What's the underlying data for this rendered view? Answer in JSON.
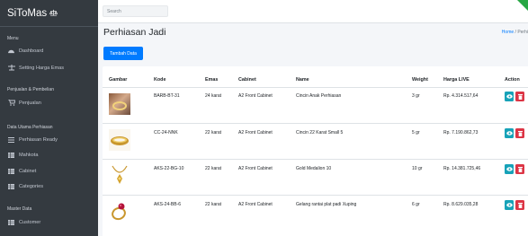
{
  "app": {
    "brand": "SiToMas"
  },
  "sidebar": {
    "sections": [
      "Menu",
      "Penjualan & Pembelian",
      "Data Utama Perhiasan",
      "Master Data"
    ],
    "items": [
      {
        "label": "Dashboard",
        "icon": "dashboard-icon"
      },
      {
        "label": "Setting Harga Emas",
        "icon": "scale-icon"
      },
      {
        "label": "Penjualan",
        "icon": "cart-icon"
      },
      {
        "label": "Perhiasan Ready",
        "icon": "list-icon"
      },
      {
        "label": "Mahkota",
        "icon": "table-icon"
      },
      {
        "label": "Cabinet",
        "icon": "table-icon"
      },
      {
        "label": "Categories",
        "icon": "table-icon"
      },
      {
        "label": "Customer",
        "icon": "table-icon"
      }
    ]
  },
  "topbar": {
    "search_placeholder": "Search"
  },
  "page": {
    "title": "Perhiasan Jadi",
    "breadcrumb_home": "Home",
    "breadcrumb_sep": "/",
    "breadcrumb_current": "Perhi",
    "add_button": "Tambah Data"
  },
  "table": {
    "headers": [
      "Gambar",
      "Kode",
      "Emas",
      "Cabinet",
      "Name",
      "Weight",
      "Harga LIVE",
      "Action"
    ],
    "rows": [
      {
        "kode": "BARB-BT-31",
        "emas": "24 karat",
        "cabinet": "A2 Front Cabinet",
        "name": "Cincin Anak Perhiasan",
        "weight": "3 gr",
        "harga": "Rp. 4.314.517,64",
        "image": "ring-photo"
      },
      {
        "kode": "CC-24-NNK",
        "emas": "22 karat",
        "cabinet": "A2 Front Cabinet",
        "name": "Cincin 22 Karat Small 5",
        "weight": "5 gr",
        "harga": "Rp. 7.190.862,73",
        "image": "bangle-photo"
      },
      {
        "kode": "AKS-22-BG-10",
        "emas": "22 karat",
        "cabinet": "A2 Front Cabinet",
        "name": "Gold Medalion 10",
        "weight": "10 gr",
        "harga": "Rp. 14.381.725,46",
        "image": "necklace-photo"
      },
      {
        "kode": "AKS-24-BB-6",
        "emas": "22 karat",
        "cabinet": "A2 Front Cabinet",
        "name": "Gelang rantai plat padi Xuping",
        "weight": "6 gr",
        "harga": "Rp. 8.629.035,28",
        "image": "ruby-ring-photo"
      }
    ]
  },
  "colors": {
    "sidebar": "#343a40",
    "primary": "#007bff",
    "info": "#17a2b8",
    "danger": "#dc3545",
    "accent": "#28a745"
  }
}
